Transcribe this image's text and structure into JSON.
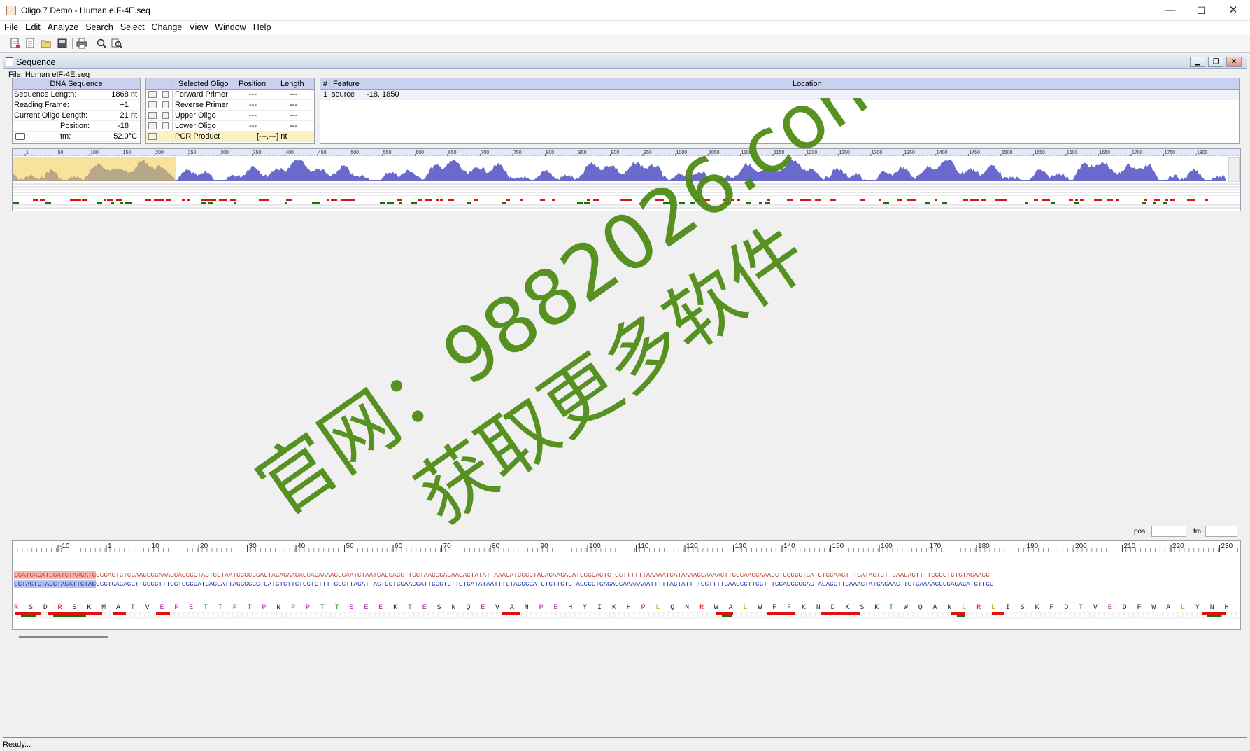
{
  "window": {
    "title": "Oligo 7 Demo - Human eIF-4E.seq",
    "minimize": "—",
    "maximize": "☐",
    "close": "✕"
  },
  "menu": [
    "File",
    "Edit",
    "Analyze",
    "Search",
    "Select",
    "Change",
    "View",
    "Window",
    "Help"
  ],
  "toolbar_icons": [
    "new-sequence-icon",
    "new-document-icon",
    "open-folder-icon",
    "save-icon",
    "print-icon",
    "find-icon",
    "find-replace-icon"
  ],
  "mdi": {
    "title": "Sequence",
    "file": "File: Human eIF-4E.seq"
  },
  "dna_panel": {
    "header": "DNA Sequence",
    "rows": [
      {
        "label": "Sequence Length:",
        "value": "1868 nt"
      },
      {
        "label": "Reading Frame:",
        "value": "+1"
      },
      {
        "label": "Current Oligo Length:",
        "value": "21 nt"
      },
      {
        "label": "Position:",
        "value": "-18"
      }
    ],
    "tm_label": "tm:",
    "tm_value": "52.0°C"
  },
  "oligo_panel": {
    "headers": [
      "Selected Oligo",
      "Position",
      "Length"
    ],
    "rows": [
      {
        "name": "Forward Primer",
        "position": "---",
        "length": "---"
      },
      {
        "name": "Reverse Primer",
        "position": "---",
        "length": "---"
      },
      {
        "name": "Upper Oligo",
        "position": "---",
        "length": "---"
      },
      {
        "name": "Lower Oligo",
        "position": "---",
        "length": "---"
      }
    ],
    "pcr": {
      "name": "PCR Product",
      "value": "[---,---] nt"
    }
  },
  "feature_panel": {
    "headers": [
      "#",
      "Feature",
      "Location"
    ],
    "rows": [
      {
        "num": "1",
        "feature": "source",
        "location": "-18..1850"
      }
    ]
  },
  "overview_ruler": [
    "1",
    "50",
    "100",
    "150",
    "200",
    "250",
    "300",
    "350",
    "400",
    "450",
    "500",
    "550",
    "600",
    "650",
    "700",
    "750",
    "800",
    "850",
    "900",
    "950",
    "1000",
    "1050",
    "1100",
    "1150",
    "1200",
    "1250",
    "1300",
    "1350",
    "1400",
    "1450",
    "1500",
    "1550",
    "1600",
    "1650",
    "1700",
    "1750",
    "1800"
  ],
  "pos_label": "pos:",
  "tm_field_label": "tm:",
  "detail_ruler": [
    "-10",
    "1",
    "10",
    "20",
    "30",
    "40",
    "50",
    "60",
    "70",
    "80",
    "90",
    "100",
    "110",
    "120",
    "130",
    "140",
    "150",
    "160",
    "170",
    "180",
    "190",
    "200",
    "210",
    "220",
    "230"
  ],
  "sequence": {
    "top": "CGATCAGATCGATCTAAGATGGCGACTGTCGAACCGGAAACCACCCCTACTCCTAATCCCCCGACTACAGAAGAGGAGAAAACGGAATCTAATCAGGAGGTTGCTAACCCAGAACACTATATTAAACATCCCCTACAGAACAGATGGGCACTCTGGTTTTTTAAAAATGATAAAAGCAAAACTTGGCAAGCAAACCTGCGGCTGATCTCCAAGTTTGATACTGTTGAAGACTTTTGGGCTCTGTACAACC",
    "bottom": "GCTAGTCTAGCTAGATTCTACCGCTGACAGCTTGGCCTTTGGTGGGGATGAGGATTAGGGGGCTGATGTCTTCTCCTCTTTTGCCTTAGATTAGTCCTCCAACGATTGGGTCTTGTGATATAATTTGTAGGGGATGTCTTGTCTACCCGTGAGACCAAAAAAATTTTTACTATTTTCGTTTTGAACCGTTCGTTTGGACGCCGACTAGAGGTTCAAACTATGACAACTTCTGAAAACCCGAGACATGTTGG",
    "amino": [
      "R",
      "S",
      "D",
      "R",
      "S",
      "K",
      "M",
      "A",
      "T",
      "V",
      "E",
      "P",
      "E",
      "T",
      "T",
      "P",
      "T",
      "P",
      "N",
      "P",
      "P",
      "T",
      "T",
      "E",
      "E",
      "E",
      "K",
      "T",
      "E",
      "S",
      "N",
      "Q",
      "E",
      "V",
      "A",
      "N",
      "P",
      "E",
      "H",
      "Y",
      "I",
      "K",
      "H",
      "P",
      "L",
      "Q",
      "N",
      "R",
      "W",
      "A",
      "L",
      "W",
      "F",
      "F",
      "K",
      "N",
      "D",
      "K",
      "S",
      "K",
      "T",
      "W",
      "Q",
      "A",
      "N",
      "L",
      "R",
      "L",
      "I",
      "S",
      "K",
      "F",
      "D",
      "T",
      "V",
      "E",
      "D",
      "F",
      "W",
      "A",
      "L",
      "Y",
      "N",
      "H"
    ]
  },
  "status": "Ready...",
  "watermark": {
    "line1": "官网：9882026.com",
    "line2": "获取更多软件"
  },
  "colors": {
    "accent_header": "#c9d1ef",
    "plot_fill": "#6a6acc",
    "plot_highlight": "#f7e39c",
    "seq_red": "#c0392b",
    "seq_blue": "#1e2f9a",
    "watermark": "#4a8a10"
  }
}
